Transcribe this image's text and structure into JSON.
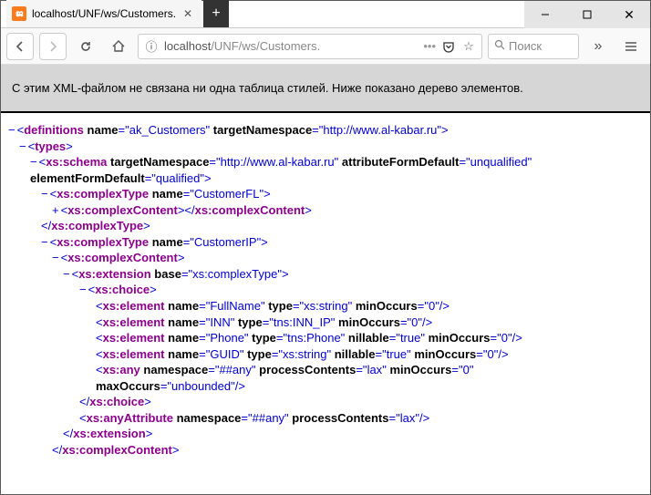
{
  "titlebar": {
    "tab_title": "localhost/UNF/ws/Customers."
  },
  "toolbar": {
    "url_prefix": "localhost",
    "url_path": "/UNF/ws/Customers.",
    "search_placeholder": "Поиск"
  },
  "banner": "С этим XML-файлом не связана ни одна таблица стилей. Ниже показано дерево элементов.",
  "xml": {
    "ns": "http://www.al-kabar.ru",
    "root_name": "ak_Customers",
    "schema_afdefault": "unqualified",
    "schema_efdefault": "qualified",
    "ctype_fl": "CustomerFL",
    "ctype_ip": "CustomerIP",
    "ext_base": "xs:complexType",
    "el_fullname": {
      "name": "FullName",
      "type": "xs:string",
      "minOccurs": "0"
    },
    "el_inn": {
      "name": "INN",
      "type": "tns:INN_IP",
      "minOccurs": "0"
    },
    "el_phone": {
      "name": "Phone",
      "type": "tns:Phone",
      "nillable": "true",
      "minOccurs": "0"
    },
    "el_guid": {
      "name": "GUID",
      "type": "xs:string",
      "nillable": "true",
      "minOccurs": "0"
    },
    "any": {
      "namespace": "##any",
      "processContents": "lax",
      "minOccurs": "0",
      "maxOccurs": "unbounded"
    },
    "anyattr": {
      "namespace": "##any",
      "processContents": "lax"
    }
  }
}
